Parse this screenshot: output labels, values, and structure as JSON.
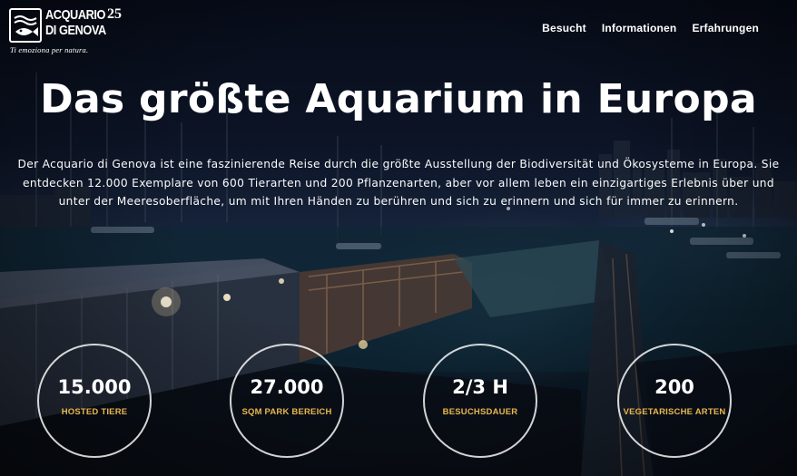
{
  "brand": {
    "name_line1": "ACQUARIO",
    "name_line2": "DI GENOVA",
    "badge": "25",
    "tagline": "Ti emoziona per natura."
  },
  "nav": {
    "items": [
      "Besucht",
      "Informationen",
      "Erfahrungen"
    ]
  },
  "hero": {
    "title": "Das größte Aquarium in Europa",
    "description": "Der Acquario di Genova ist eine faszinierende Reise durch die größte Ausstellung der Biodiversität und Ökosysteme in Europa. Sie entdecken 12.000 Exemplare von 600 Tierarten und 200 Pflanzenarten, aber vor allem leben ein einzigartiges Erlebnis über und unter der Meeresoberfläche, um mit Ihren Händen zu berühren und sich zu erinnern und sich für immer zu erinnern."
  },
  "stats": [
    {
      "value": "15.000",
      "label": "HOSTED TIERE"
    },
    {
      "value": "27.000",
      "label": "SQM PARK BEREICH"
    },
    {
      "value": "2/3 H",
      "label": "BESUCHSDAUER"
    },
    {
      "value": "200",
      "label": "VEGETARISCHE ARTEN"
    }
  ],
  "colors": {
    "accent": "#e9b64f",
    "text": "#ffffff",
    "background": "#0c1426"
  }
}
